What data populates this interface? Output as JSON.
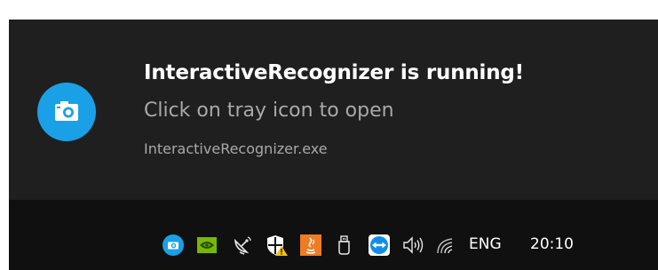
{
  "toast": {
    "app_icon": "camera-icon",
    "title": "InteractiveRecognizer is running!",
    "body": "Click on tray icon to open",
    "attribution": "InteractiveRecognizer.exe"
  },
  "taskbar": {
    "tray_icons": [
      "interactive-recognizer-camera-icon",
      "nvidia-icon",
      "network-satellite-icon",
      "windows-defender-warning-icon",
      "java-icon",
      "usb-device-icon",
      "teamviewer-icon",
      "speaker-volume-icon",
      "wifi-icon"
    ],
    "language": "ENG",
    "clock": "20:10"
  },
  "colors": {
    "toast_background": "#1f1f1f",
    "taskbar_background": "#101010",
    "accent_blue": "#1aa0e6",
    "secondary_text": "#a9a9a9"
  }
}
